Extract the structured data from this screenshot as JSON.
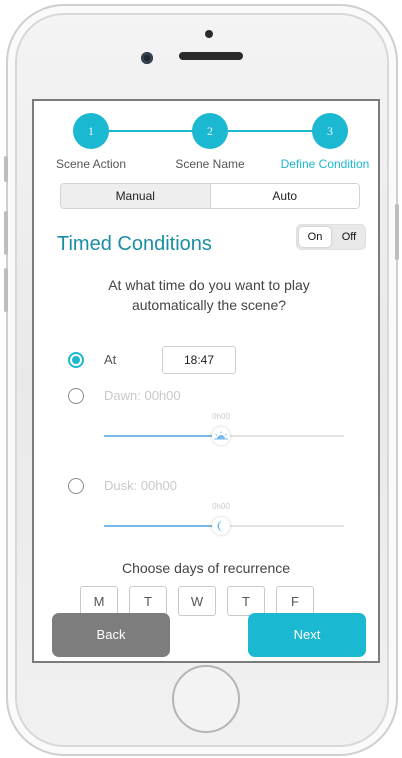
{
  "steps": [
    {
      "number": "1",
      "label": "Scene Action"
    },
    {
      "number": "2",
      "label": "Scene Name"
    },
    {
      "number": "3",
      "label": "Define Condition"
    }
  ],
  "mode_tabs": {
    "manual": "Manual",
    "auto": "Auto",
    "selected": "Auto"
  },
  "section_title": "Timed Conditions",
  "toggle": {
    "on": "On",
    "off": "Off",
    "state": "On"
  },
  "question": "At what time do you want to play automatically the scene?",
  "options": {
    "at": {
      "label": "At",
      "time": "18:47",
      "checked": true
    },
    "dawn": {
      "label": "Dawn: 00h00",
      "slider_value": "0h00",
      "checked": false
    },
    "dusk": {
      "label": "Dusk: 00h00",
      "slider_value": "0h00",
      "checked": false
    }
  },
  "days_title": "Choose days of recurrence",
  "days": [
    "M",
    "T",
    "W",
    "T",
    "F"
  ],
  "buttons": {
    "back": "Back",
    "next": "Next"
  },
  "colors": {
    "accent": "#1bb8d2",
    "title": "#1b8ea5",
    "back_button": "#7d7d7d",
    "slider_fill": "#79b8e8"
  },
  "icons": {
    "dawn_thumb": "sunrise-icon",
    "dusk_thumb": "moon-icon"
  }
}
